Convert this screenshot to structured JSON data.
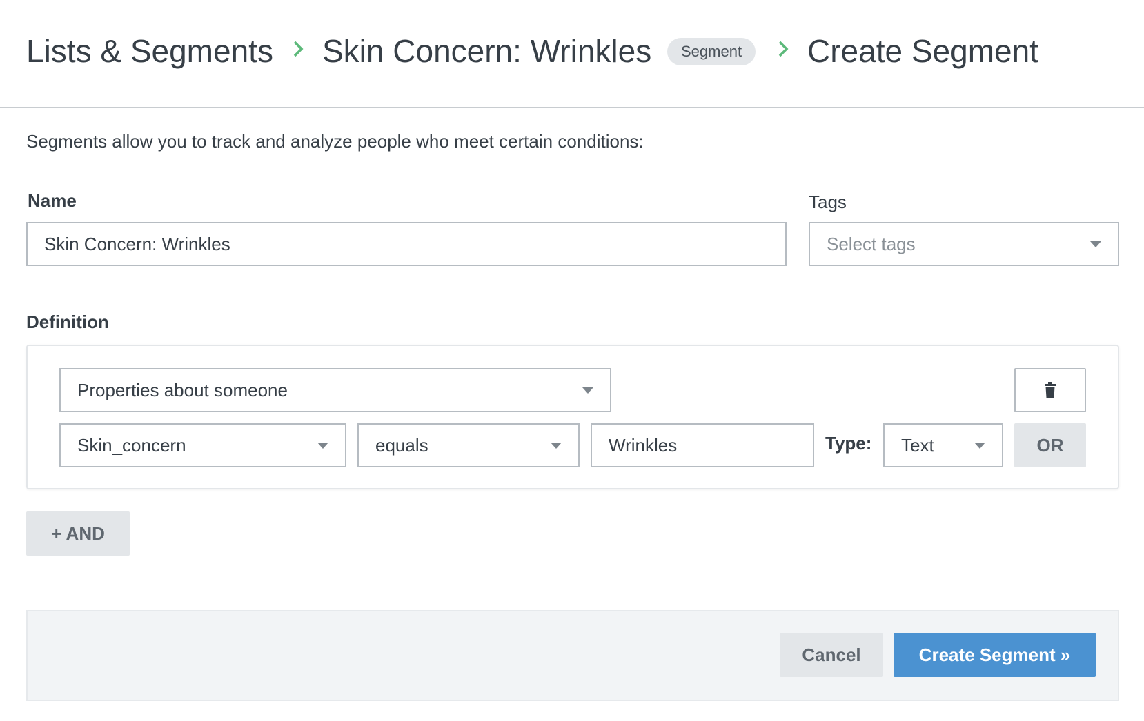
{
  "breadcrumb": {
    "items": [
      "Lists & Segments",
      "Skin Concern: Wrinkles",
      "Create Segment"
    ],
    "badge": "Segment"
  },
  "intro_text": "Segments allow you to track and analyze people who meet certain conditions:",
  "name_field": {
    "label": "Name",
    "value": "Skin Concern: Wrinkles"
  },
  "tags_field": {
    "label": "Tags",
    "placeholder": "Select tags"
  },
  "definition": {
    "label": "Definition",
    "condition_type": "Properties about someone",
    "property": "Skin_concern",
    "operator": "equals",
    "value": "Wrinkles",
    "type_label": "Type:",
    "type_value": "Text",
    "or_label": "OR"
  },
  "and_button": "+ AND",
  "footer": {
    "cancel_label": "Cancel",
    "create_label": "Create Segment »"
  },
  "colors": {
    "accent_green": "#5cb97a",
    "primary_blue": "#4b92d1"
  }
}
